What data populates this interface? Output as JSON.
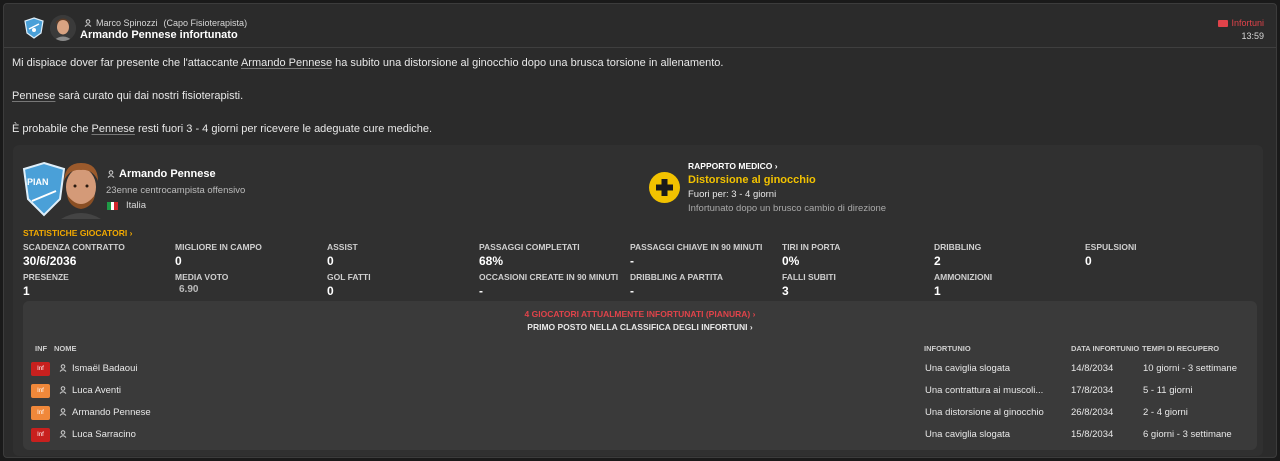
{
  "header": {
    "sender": "Marco Spinozzi",
    "sender_role": "(Capo Fisioterapista)",
    "subject": "Armando Pennese infortunato",
    "tag_label": "Infortuni",
    "time": "13:59"
  },
  "message": {
    "l1_a": "Mi dispiace dover far presente che l'attaccante ",
    "l1_player": "Armando Pennese",
    "l1_b": " ha subito una distorsione al ginocchio dopo una brusca torsione in allenamento.",
    "l2_player": "Pennese",
    "l2_b": " sarà curato qui dai nostri fisioterapisti.",
    "l3_a": "È probabile che ",
    "l3_player": "Pennese",
    "l3_b": " resti fuori 3 - 4 giorni per ricevere le adeguate cure mediche."
  },
  "player": {
    "name": "Armando Pennese",
    "description": "23enne centrocampista offensivo",
    "nationality": "Italia",
    "club_short": "PIAN"
  },
  "medical": {
    "title": "RAPPORTO MEDICO",
    "injury": "Distorsione al ginocchio",
    "out_for": "Fuori per: 3 - 4 giorni",
    "cause": "Infortunato dopo un brusco cambio di direzione"
  },
  "stats": {
    "link": "STATISTICHE GIOCATORI",
    "items": [
      {
        "label": "SCADENZA CONTRATTO",
        "value": "30/6/2036"
      },
      {
        "label": "MIGLIORE IN CAMPO",
        "value": "0"
      },
      {
        "label": "ASSIST",
        "value": "0"
      },
      {
        "label": "PASSAGGI COMPLETATI",
        "value": "68%"
      },
      {
        "label": "PASSAGGI CHIAVE IN 90 MINUTI",
        "value": "-"
      },
      {
        "label": "TIRI IN PORTA",
        "value": "0%"
      },
      {
        "label": "DRIBBLING",
        "value": "2"
      },
      {
        "label": "ESPULSIONI",
        "value": "0"
      },
      {
        "label": "PRESENZE",
        "value": "1"
      },
      {
        "label": "MEDIA VOTO",
        "value": "6.90"
      },
      {
        "label": "GOL FATTI",
        "value": "0"
      },
      {
        "label": "OCCASIONI CREATE IN 90 MINUTI",
        "value": "-"
      },
      {
        "label": "DRIBBLING A PARTITA",
        "value": "-"
      },
      {
        "label": "FALLI SUBITI",
        "value": "3"
      },
      {
        "label": "AMMONIZIONI",
        "value": "1"
      }
    ]
  },
  "injuries": {
    "link_injured": "4 GIOCATORI ATTUALMENTE INFORTUNATI (PIANURA)",
    "link_rank": "PRIMO POSTO NELLA CLASSIFICA DEGLI INFORTUNI",
    "headers": {
      "inf": "INF",
      "name": "NOME",
      "injury": "INFORTUNIO",
      "date": "DATA INFORTUNIO",
      "recovery": "TEMPI DI RECUPERO"
    },
    "rows": [
      {
        "badge": "Inf",
        "badge_color": "#c8201e",
        "name": "Ismaël Badaoui",
        "injury": "Una caviglia slogata",
        "date": "14/8/2034",
        "recovery": "10 giorni - 3 settimane"
      },
      {
        "badge": "Inf",
        "badge_color": "#f0883a",
        "name": "Luca Aventi",
        "injury": "Una contrattura ai muscoli...",
        "date": "17/8/2034",
        "recovery": "5 - 11 giorni"
      },
      {
        "badge": "Inf",
        "badge_color": "#f0883a",
        "name": "Armando Pennese",
        "injury": "Una distorsione al ginocchio",
        "date": "26/8/2034",
        "recovery": "2 - 4 giorni"
      },
      {
        "badge": "Inf",
        "badge_color": "#c8201e",
        "name": "Luca Sarracino",
        "injury": "Una caviglia slogata",
        "date": "15/8/2034",
        "recovery": "6 giorni - 3 settimane"
      }
    ]
  }
}
